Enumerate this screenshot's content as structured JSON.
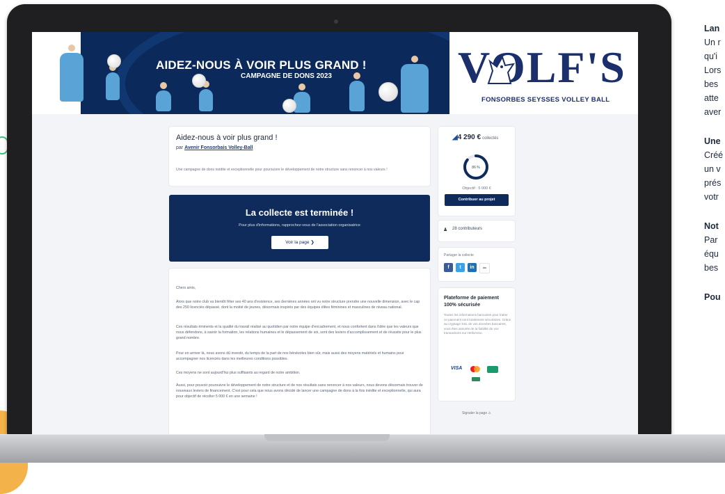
{
  "banner": {
    "headline": "AIDEZ-NOUS À VOIR PLUS GRAND !",
    "subline": "CAMPAGNE DE DONS 2023",
    "logo": "VOLF'S",
    "club_name": "FONSORBES SEYSSES VOLLEY BALL"
  },
  "campaign": {
    "title": "Aidez-nous à voir plus grand !",
    "by_prefix": "par",
    "organizer": "Avenir Fonsorbais Volley-Ball",
    "description": "Une campagne de dons inédite et exceptionnelle pour poursuivre le développement de notre structure sans renoncer à nos valeurs !"
  },
  "ended": {
    "heading": "La collecte est terminée !",
    "text": "Pour plus d'informations, rapprochez-vous de l'association organisatrice",
    "button": "Voir la page ❯"
  },
  "body": {
    "greeting": "Chers amis,",
    "p1": "Alors que notre club va bientôt fêter ses 40 ans d'existence, ses dernières années ont vu notre structure prendre une nouvelle dimension, avec le cap des 250 licenciés dépassé, dont la moitié de jeunes, désormais inspirés par des équipes élites féminines et masculines de niveau national.",
    "p2": "Ces résultats éminents et la qualité du travail réalisé au quotidien par notre équipe d'encadrement, et nous confortent dans l'idée que les valeurs que nous défendons, à savoir la formation, les relations humaines et le dépassement de soi, sont des leviers d'accomplissement et de réussite pour le plus grand nombre.",
    "p3": "Pour en arriver là, nous avons dû investir, du temps de la part de nos bénévoles bien sûr, mais aussi des moyens matériels et humains pour accompagner nos licenciés dans les meilleures conditions possibles.",
    "p4": "Ces moyens ne sont aujourd'hui plus suffisants au regard de notre ambition.",
    "p5": "Aussi, pour pouvoir poursuivre le développement de notre structure et de nos résultats sans renoncer à nos valeurs, nous devons désormais trouver de nouveaux leviers de financement. C'est pour cela que nous avons décidé de lancer une campagne de dons à la fois inédite et exceptionnelle, qui aura pour objectif de récolter 5 000 € en une semaine !"
  },
  "sidebar": {
    "amount": "4 290 €",
    "amount_suffix": "collectés",
    "percent": "86 %",
    "percent_value": 0.86,
    "goal": "Objectif : 5 000 €",
    "contribute_button": "Contribuer au projet",
    "contributors": "28 contributeurs",
    "share_label": "Partager la collecte",
    "share_icons": [
      "facebook-icon",
      "twitter-icon",
      "linkedin-icon",
      "link-icon"
    ],
    "payment_title": "Plateforme de paiement 100% sécurisée",
    "payment_text": "Toutes les informations bancaires pour traiter ce paiement sont totalement sécurisées. Grâce au cryptage SSL de vos données bancaires, vous êtes assurés de la fiabilité de vos transactions sur HelloAsso.",
    "report": "Signaler la page ⚠"
  },
  "right_column": {
    "l1": "Lan",
    "l2": "Un r",
    "l3": "qu'i",
    "l4": "Lors",
    "l5": "bes",
    "l6": "atte",
    "l7": "aver",
    "l8": "Une",
    "l9": "Créé",
    "l10": "un v",
    "l11": "prés",
    "l12": "votr",
    "l13": "Not",
    "l14": "Par",
    "l15": "équ",
    "l16": "bes",
    "l17": "Pou"
  },
  "colors": {
    "navy": "#0f2b5b",
    "accent_blue": "#1d4f9a",
    "page_bg": "#f2f4f7"
  }
}
